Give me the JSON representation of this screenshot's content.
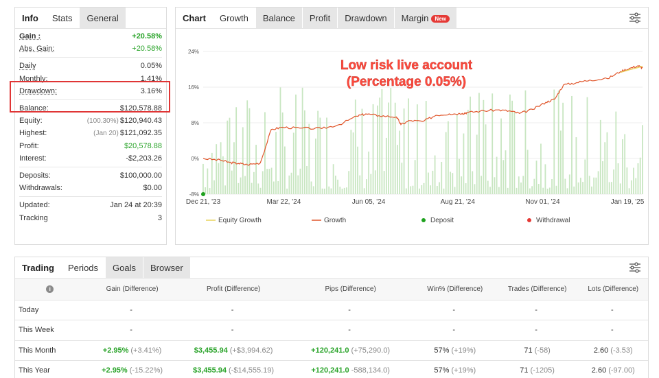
{
  "info": {
    "tabs": [
      "Info",
      "Stats",
      "General"
    ],
    "rows": {
      "gain": {
        "label": "Gain :",
        "value": "+20.58%"
      },
      "abs_gain": {
        "label": "Abs. Gain:",
        "value": "+20.58%"
      },
      "daily": {
        "label": "Daily",
        "value": "0.05%"
      },
      "monthly": {
        "label": "Monthly:",
        "value": "1.41%"
      },
      "drawdown": {
        "label": "Drawdown:",
        "value": "3.16%"
      },
      "balance": {
        "label": "Balance:",
        "value": "$120,578.88"
      },
      "equity": {
        "label": "Equity:",
        "sub": "(100.30%)",
        "value": "$120,940.43"
      },
      "highest": {
        "label": "Highest:",
        "sub": "(Jan 20)",
        "value": "$121,092.35"
      },
      "profit": {
        "label": "Profit:",
        "value": "$20,578.88"
      },
      "interest": {
        "label": "Interest:",
        "value": "-$2,203.26"
      },
      "deposits": {
        "label": "Deposits:",
        "value": "$100,000.00"
      },
      "withdrawals": {
        "label": "Withdrawals:",
        "value": "$0.00"
      },
      "updated": {
        "label": "Updated:",
        "value": "Jan 24 at 20:39"
      },
      "tracking": {
        "label": "Tracking",
        "value": "3"
      }
    }
  },
  "chart_panel": {
    "tabs": [
      "Chart",
      "Growth",
      "Balance",
      "Profit",
      "Drawdown",
      "Margin"
    ],
    "margin_badge": "New",
    "annotation_line1": "Low risk live account",
    "annotation_line2": "(Percentage 0.05%)",
    "settings_icon": "sliders-icon"
  },
  "chart_data": {
    "type": "line",
    "y_ticks": [
      "24%",
      "16%",
      "8%",
      "0%",
      "-8%"
    ],
    "x_ticks": [
      "Dec 21, '23",
      "Mar 22, '24",
      "Jun 05, '24",
      "Aug 21, '24",
      "Nov 01, '24",
      "Jan 19, '25"
    ],
    "ylim": [
      -8,
      24
    ],
    "legend": [
      "Equity Growth",
      "Growth",
      "Deposit",
      "Withdrawal"
    ],
    "legend_placement": "bottom",
    "colors": {
      "equity": "#e8d25a",
      "growth": "#e0552a",
      "deposit": "#1ea11e",
      "withdrawal": "#e53935",
      "bars": "#c8e6c1"
    },
    "growth_points": [
      [
        0,
        0
      ],
      [
        0.04,
        -0.4
      ],
      [
        0.06,
        -0.9
      ],
      [
        0.08,
        -1.1
      ],
      [
        0.1,
        -1.4
      ],
      [
        0.13,
        -1.0
      ],
      [
        0.155,
        6.5
      ],
      [
        0.18,
        7.0
      ],
      [
        0.22,
        6.8
      ],
      [
        0.27,
        6.7
      ],
      [
        0.31,
        7.6
      ],
      [
        0.35,
        9.5
      ],
      [
        0.37,
        10.0
      ],
      [
        0.4,
        9.6
      ],
      [
        0.44,
        9.3
      ],
      [
        0.45,
        7.6
      ],
      [
        0.47,
        8.5
      ],
      [
        0.5,
        8.3
      ],
      [
        0.53,
        9.7
      ],
      [
        0.56,
        10.0
      ],
      [
        0.59,
        10.1
      ],
      [
        0.6,
        10.3
      ],
      [
        0.63,
        10.6
      ],
      [
        0.67,
        10.9
      ],
      [
        0.7,
        10.6
      ],
      [
        0.72,
        10.1
      ],
      [
        0.75,
        11.0
      ],
      [
        0.78,
        12.6
      ],
      [
        0.8,
        13.3
      ],
      [
        0.82,
        16.5
      ],
      [
        0.85,
        17.0
      ],
      [
        0.88,
        17.6
      ],
      [
        0.92,
        17.9
      ],
      [
        0.95,
        19.5
      ],
      [
        0.97,
        20.2
      ],
      [
        0.99,
        20.8
      ],
      [
        1,
        20.3
      ]
    ],
    "equity_points": [
      [
        0.95,
        19.3
      ],
      [
        0.97,
        19.9
      ],
      [
        0.99,
        20.4
      ],
      [
        1,
        20.7
      ]
    ],
    "bar_count": 200,
    "deposit_x": 0
  },
  "trading": {
    "tabs": [
      "Trading",
      "Periods",
      "Goals",
      "Browser"
    ],
    "headers": [
      "Gain (Difference)",
      "Profit (Difference)",
      "Pips (Difference)",
      "Win% (Difference)",
      "Trades (Difference)",
      "Lots (Difference)"
    ],
    "rows": [
      {
        "period": "Today",
        "gain": "-",
        "gain_d": "",
        "profit": "-",
        "profit_d": "",
        "pips": "-",
        "pips_d": "",
        "win": "-",
        "win_d": "",
        "trades": "-",
        "trades_d": "",
        "lots": "-",
        "lots_d": ""
      },
      {
        "period": "This Week",
        "gain": "-",
        "gain_d": "",
        "profit": "-",
        "profit_d": "",
        "pips": "-",
        "pips_d": "",
        "win": "-",
        "win_d": "",
        "trades": "-",
        "trades_d": "",
        "lots": "-",
        "lots_d": ""
      },
      {
        "period": "This Month",
        "gain": "+2.95%",
        "gain_d": "(+3.41%)",
        "profit": "$3,455.94",
        "profit_d": "(+$3,994.62)",
        "pips": "+120,241.0",
        "pips_d": "(+75,290.0)",
        "win": "57%",
        "win_d": "(+19%)",
        "trades": "71",
        "trades_d": "(-58)",
        "lots": "2.60",
        "lots_d": "(-3.53)"
      },
      {
        "period": "This Year",
        "gain": "+2.95%",
        "gain_d": "(-15.22%)",
        "profit": "$3,455.94",
        "profit_d": "(-$14,555.19)",
        "pips": "+120,241.0",
        "pips_d": "-588,134.0)",
        "win": "57%",
        "win_d": "(+19%)",
        "trades": "71",
        "trades_d": "(-1205)",
        "lots": "2.60",
        "lots_d": "(-97.00)"
      }
    ]
  }
}
